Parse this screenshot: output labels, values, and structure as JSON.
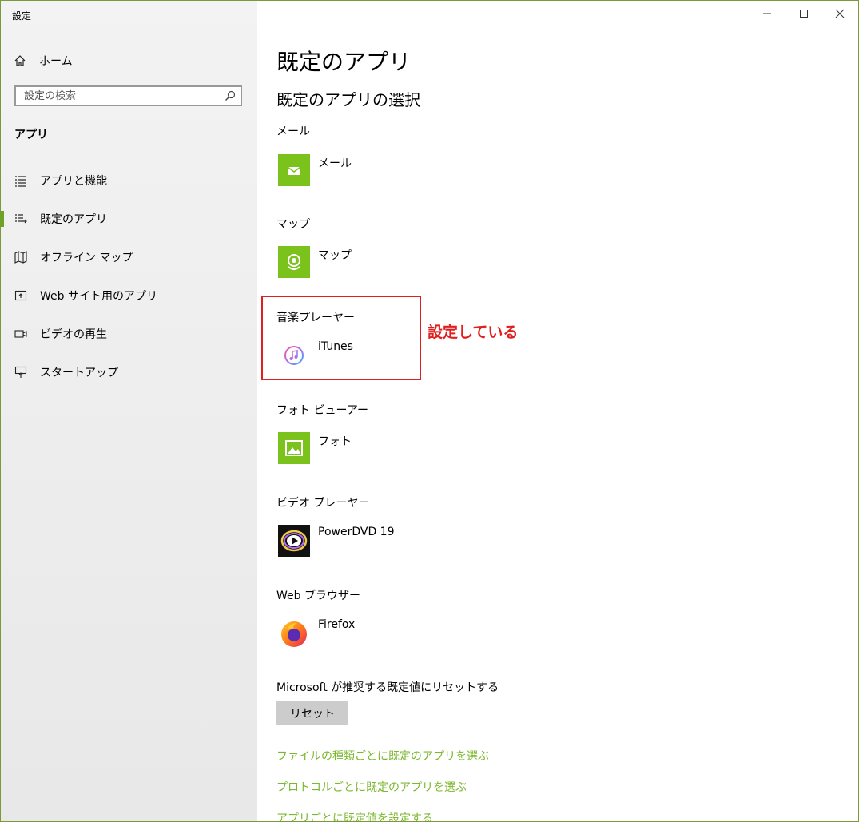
{
  "window": {
    "title": "設定"
  },
  "sidebar": {
    "home_label": "ホーム",
    "search_placeholder": "設定の検索",
    "section_title": "アプリ",
    "items": [
      {
        "label": "アプリと機能",
        "icon": "list-icon",
        "active": false
      },
      {
        "label": "既定のアプリ",
        "icon": "default-apps-icon",
        "active": true
      },
      {
        "label": "オフライン マップ",
        "icon": "map-icon",
        "active": false
      },
      {
        "label": "Web サイト用のアプリ",
        "icon": "web-app-icon",
        "active": false
      },
      {
        "label": "ビデオの再生",
        "icon": "video-icon",
        "active": false
      },
      {
        "label": "スタートアップ",
        "icon": "startup-icon",
        "active": false
      }
    ]
  },
  "main": {
    "title": "既定のアプリ",
    "subtitle": "既定のアプリの選択",
    "categories": [
      {
        "label": "メール",
        "app": "メール",
        "icon": "mail-icon"
      },
      {
        "label": "マップ",
        "app": "マップ",
        "icon": "maps-icon"
      },
      {
        "label": "音楽プレーヤー",
        "app": "iTunes",
        "icon": "itunes-icon"
      },
      {
        "label": "フォト ビューアー",
        "app": "フォト",
        "icon": "photos-icon"
      },
      {
        "label": "ビデオ プレーヤー",
        "app": "PowerDVD 19",
        "icon": "powerdvd-icon"
      },
      {
        "label": "Web ブラウザー",
        "app": "Firefox",
        "icon": "firefox-icon"
      }
    ],
    "reset_label": "Microsoft が推奨する既定値にリセットする",
    "reset_button": "リセット",
    "links": [
      "ファイルの種類ごとに既定のアプリを選ぶ",
      "プロトコルごとに既定のアプリを選ぶ",
      "アプリごとに既定値を設定する"
    ]
  },
  "annotation": {
    "text": "設定している"
  },
  "colors": {
    "accent": "#6aa51f",
    "tile_green": "#7cc21d",
    "link": "#7cb82f",
    "annotation": "#e02020"
  }
}
